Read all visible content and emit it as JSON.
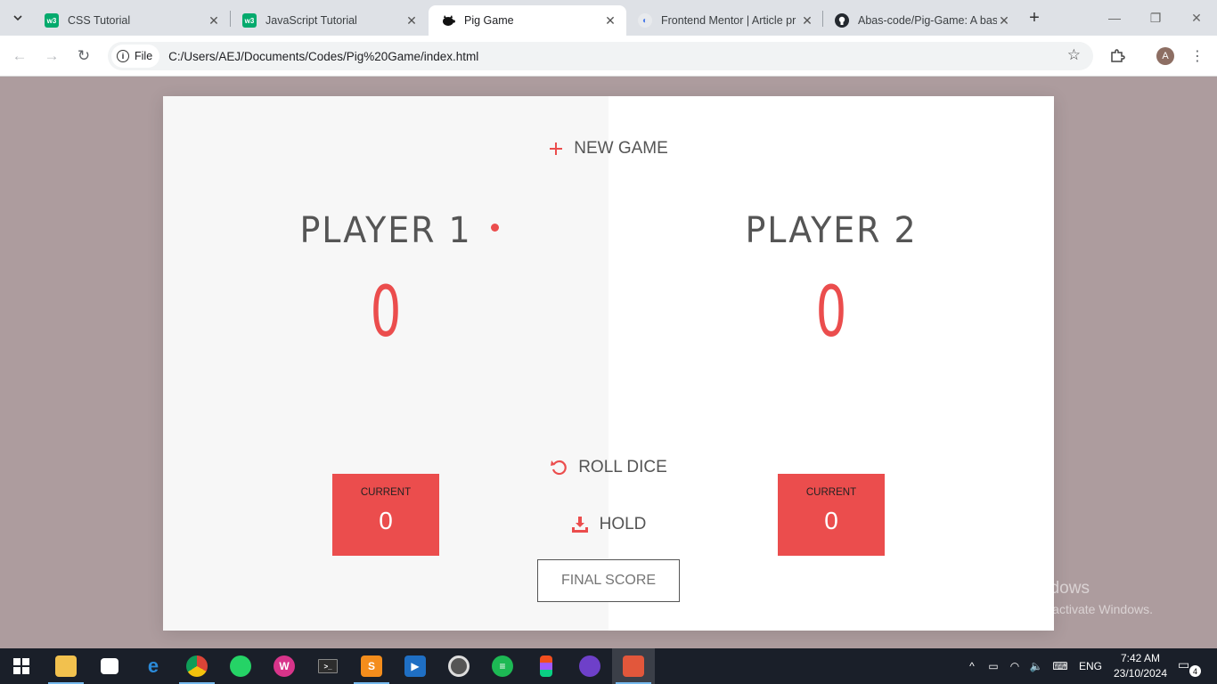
{
  "browser": {
    "tabs": [
      {
        "title": "CSS Tutorial",
        "favicon": "w3schools-icon",
        "badge": "w3"
      },
      {
        "title": "JavaScript Tutorial",
        "favicon": "w3schools-icon",
        "badge": "w3"
      },
      {
        "title": "Pig Game",
        "favicon": "pig-icon",
        "active": true
      },
      {
        "title": "Frontend Mentor | Article pr",
        "favicon": "frontend-mentor-icon"
      },
      {
        "title": "Abas-code/Pig-Game: A bas",
        "favicon": "github-icon"
      }
    ],
    "address": {
      "chip_label": "File",
      "url": "C:/Users/AEJ/Documents/Codes/Pig%20Game/index.html"
    },
    "profile_initial": "A"
  },
  "game": {
    "new_game_label": "NEW GAME",
    "roll_dice_label": "ROLL DICE",
    "hold_label": "HOLD",
    "final_score_placeholder": "FINAL SCORE",
    "players": [
      {
        "name": "PLAYER 1",
        "score": "0",
        "current_label": "CURRENT",
        "current_score": "0",
        "active": true
      },
      {
        "name": "PLAYER 2",
        "score": "0",
        "current_label": "CURRENT",
        "current_score": "0",
        "active": false
      }
    ],
    "accent_color": "#eb4d4d"
  },
  "watermark": {
    "line1": "Activate Windows",
    "line2": "Go to Settings to activate Windows."
  },
  "taskbar": {
    "apps": [
      "start-icon",
      "file-explorer-icon",
      "store-icon",
      "edge-icon",
      "chrome-icon",
      "whatsapp-icon",
      "wps-icon",
      "terminal-icon",
      "sublime-icon",
      "media-player-icon",
      "groove-icon",
      "spotify-icon",
      "figma-icon",
      "github-desktop-icon",
      "app-icon"
    ],
    "language": "ENG",
    "time": "7:42 AM",
    "date": "23/10/2024",
    "notifications": "4"
  }
}
